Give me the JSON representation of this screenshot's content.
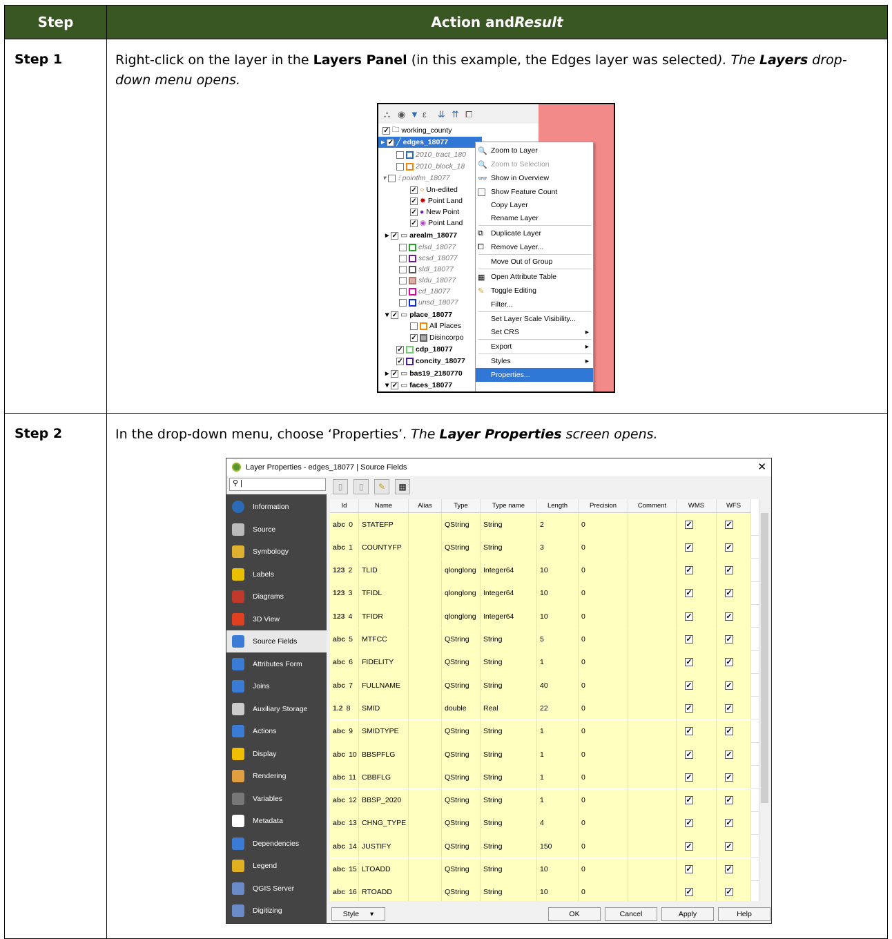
{
  "table": {
    "header_step": "Step",
    "header_action": "Action and ",
    "header_result": "Result",
    "rows": [
      {
        "step": "Step 1",
        "t1": "Right-click on the layer in the ",
        "b1": "Layers Panel",
        "t2": " (in this example, the Edges layer was selected",
        "i1": "). The ",
        "bi1": "Layers",
        "i2": " drop-down menu opens."
      },
      {
        "step": "Step 2",
        "t1": "In the drop-down menu, choose ‘Properties’. ",
        "i1": "The ",
        "bi1": "Layer Properties",
        "i2": " screen opens."
      }
    ]
  },
  "layers_panel": {
    "items": [
      {
        "label": "working_county"
      },
      {
        "label": "edges_18077"
      },
      {
        "label": "2010_tract_180"
      },
      {
        "label": "2010_block_18"
      },
      {
        "label": "pointlm_18077"
      },
      {
        "label": "Un-edited"
      },
      {
        "label": "Point Land"
      },
      {
        "label": "New Point"
      },
      {
        "label": "Point Land"
      },
      {
        "label": "arealm_18077"
      },
      {
        "label": "elsd_18077"
      },
      {
        "label": "scsd_18077"
      },
      {
        "label": "sldl_18077"
      },
      {
        "label": "sldu_18077"
      },
      {
        "label": "cd_18077"
      },
      {
        "label": "unsd_18077"
      },
      {
        "label": "place_18077"
      },
      {
        "label": "All Places"
      },
      {
        "label": "Disincorpo"
      },
      {
        "label": "cdp_18077"
      },
      {
        "label": "concity_18077"
      },
      {
        "label": "bas19_2180770"
      },
      {
        "label": "faces_18077"
      }
    ],
    "menu": [
      "Zoom to Layer",
      "Zoom to Selection",
      "Show in Overview",
      "Show Feature Count",
      "Copy Layer",
      "Rename Layer",
      "Duplicate Layer",
      "Remove Layer...",
      "Move Out of Group",
      "Open Attribute Table",
      "Toggle Editing",
      "Filter...",
      "Set Layer Scale Visibility...",
      "Set CRS",
      "Export",
      "Styles",
      "Properties..."
    ]
  },
  "layer_properties": {
    "title": "Layer Properties - edges_18077 | Source Fields",
    "search_value": "|",
    "sidebar": [
      "Information",
      "Source",
      "Symbology",
      "Labels",
      "Diagrams",
      "3D View",
      "Source Fields",
      "Attributes Form",
      "Joins",
      "Auxiliary Storage",
      "Actions",
      "Display",
      "Rendering",
      "Variables",
      "Metadata",
      "Dependencies",
      "Legend",
      "QGIS Server",
      "Digitizing"
    ],
    "columns": [
      "Id",
      "Name",
      "Alias",
      "Type",
      "Type name",
      "Length",
      "Precision",
      "Comment",
      "WMS",
      "WFS"
    ],
    "fields": [
      {
        "pre": "abc",
        "id": "0",
        "name": "STATEFP",
        "type": "QString",
        "tname": "String",
        "len": "2",
        "prec": "0"
      },
      {
        "pre": "abc",
        "id": "1",
        "name": "COUNTYFP",
        "type": "QString",
        "tname": "String",
        "len": "3",
        "prec": "0"
      },
      {
        "pre": "123",
        "id": "2",
        "name": "TLID",
        "type": "qlonglong",
        "tname": "Integer64",
        "len": "10",
        "prec": "0"
      },
      {
        "pre": "123",
        "id": "3",
        "name": "TFIDL",
        "type": "qlonglong",
        "tname": "Integer64",
        "len": "10",
        "prec": "0"
      },
      {
        "pre": "123",
        "id": "4",
        "name": "TFIDR",
        "type": "qlonglong",
        "tname": "Integer64",
        "len": "10",
        "prec": "0"
      },
      {
        "pre": "abc",
        "id": "5",
        "name": "MTFCC",
        "type": "QString",
        "tname": "String",
        "len": "5",
        "prec": "0"
      },
      {
        "pre": "abc",
        "id": "6",
        "name": "FIDELITY",
        "type": "QString",
        "tname": "String",
        "len": "1",
        "prec": "0"
      },
      {
        "pre": "abc",
        "id": "7",
        "name": "FULLNAME",
        "type": "QString",
        "tname": "String",
        "len": "40",
        "prec": "0"
      },
      {
        "pre": "1.2",
        "id": "8",
        "name": "SMID",
        "type": "double",
        "tname": "Real",
        "len": "22",
        "prec": "0"
      },
      {
        "pre": "abc",
        "id": "9",
        "name": "SMIDTYPE",
        "type": "QString",
        "tname": "String",
        "len": "1",
        "prec": "0"
      },
      {
        "pre": "abc",
        "id": "10",
        "name": "BBSPFLG",
        "type": "QString",
        "tname": "String",
        "len": "1",
        "prec": "0"
      },
      {
        "pre": "abc",
        "id": "11",
        "name": "CBBFLG",
        "type": "QString",
        "tname": "String",
        "len": "1",
        "prec": "0"
      },
      {
        "pre": "abc",
        "id": "12",
        "name": "BBSP_2020",
        "type": "QString",
        "tname": "String",
        "len": "1",
        "prec": "0"
      },
      {
        "pre": "abc",
        "id": "13",
        "name": "CHNG_TYPE",
        "type": "QString",
        "tname": "String",
        "len": "4",
        "prec": "0"
      },
      {
        "pre": "abc",
        "id": "14",
        "name": "JUSTIFY",
        "type": "QString",
        "tname": "String",
        "len": "150",
        "prec": "0"
      },
      {
        "pre": "abc",
        "id": "15",
        "name": "LTOADD",
        "type": "QString",
        "tname": "String",
        "len": "10",
        "prec": "0"
      },
      {
        "pre": "abc",
        "id": "16",
        "name": "RTOADD",
        "type": "QString",
        "tname": "String",
        "len": "10",
        "prec": "0"
      }
    ],
    "check_mark": "✓",
    "buttons": {
      "style": "Style",
      "ok": "OK",
      "cancel": "Cancel",
      "apply": "Apply",
      "help": "Help"
    }
  }
}
